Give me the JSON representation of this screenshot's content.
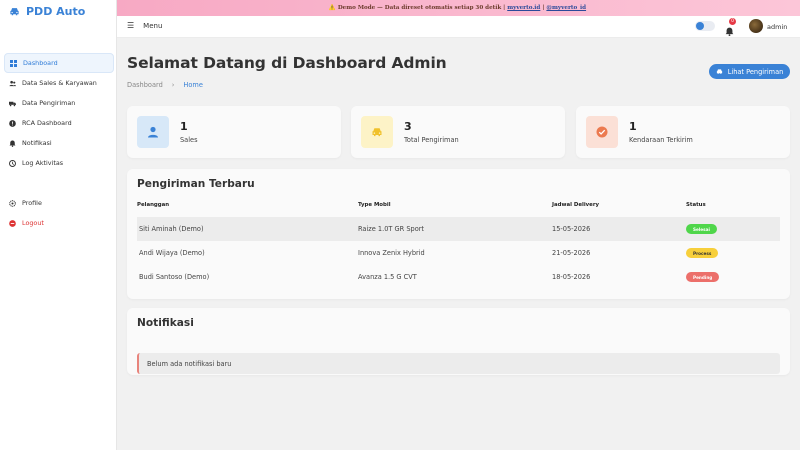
{
  "app": {
    "brand": "PDD Auto"
  },
  "banner": {
    "prefix": "⚠️ Demo Mode — Data direset otomatis setiap 30 detik | ",
    "link1": "myverto.id",
    "sep": " | ",
    "link2": "@myverto_id"
  },
  "sidebar": {
    "items": [
      {
        "label": "Dashboard"
      },
      {
        "label": "Data Sales & Karyawan"
      },
      {
        "label": "Data Pengiriman"
      },
      {
        "label": "RCA Dashboard"
      },
      {
        "label": "Notifikasi"
      },
      {
        "label": "Log Aktivitas"
      }
    ],
    "profile": "Profile",
    "logout": "Logout"
  },
  "topbar": {
    "menu": "Menu",
    "notif_count": "0",
    "username": "admin"
  },
  "page": {
    "title": "Selamat Datang di Dashboard Admin",
    "breadcrumb": [
      "Dashboard",
      "Home"
    ],
    "cta": "Lihat Pengiriman"
  },
  "stats": [
    {
      "value": "1",
      "label": "Sales",
      "color": "#d7e8f8",
      "icon_color": "#3a82d6",
      "icon": "user-icon"
    },
    {
      "value": "3",
      "label": "Total Pengiriman",
      "color": "#fdf3c7",
      "icon_color": "#f0c12c",
      "icon": "car-icon"
    },
    {
      "value": "1",
      "label": "Kendaraan Terkirim",
      "color": "#fbe0d6",
      "icon_color": "#ec7a4f",
      "icon": "check-icon"
    }
  ],
  "shipments": {
    "title": "Pengiriman Terbaru",
    "columns": [
      "Pelanggan",
      "Type Mobil",
      "Jadwal Delivery",
      "Status"
    ],
    "rows": [
      {
        "customer": "Siti Aminah (Demo)",
        "car": "Raize 1.0T GR Sport",
        "date": "15-05-2026",
        "status": "Selesai",
        "status_bg": "#4fd64a",
        "status_fg": "#ffffff"
      },
      {
        "customer": "Andi Wijaya (Demo)",
        "car": "Innova Zenix Hybrid",
        "date": "21-05-2026",
        "status": "Process",
        "status_bg": "#f7cf3b",
        "status_fg": "#333333"
      },
      {
        "customer": "Budi Santoso (Demo)",
        "car": "Avanza 1.5 G CVT",
        "date": "18-05-2026",
        "status": "Pending",
        "status_bg": "#ec6f6a",
        "status_fg": "#ffffff"
      }
    ]
  },
  "notifications": {
    "title": "Notifikasi",
    "empty": "Belum ada notifikasi baru"
  },
  "colors": {
    "accent": "#3a82d6",
    "logout": "#dd3333"
  }
}
